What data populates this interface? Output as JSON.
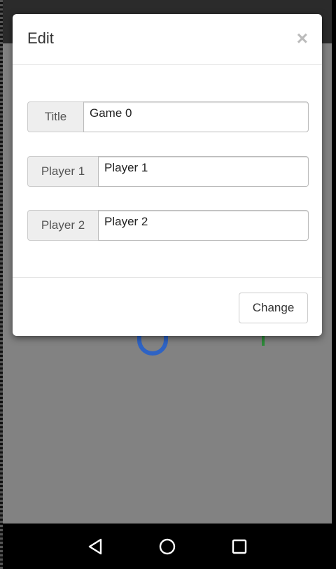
{
  "background_app": {
    "colors": {
      "content_bg": "#828282",
      "left_score_color": "#2e63c4",
      "right_score_color": "#2e8b3a"
    }
  },
  "dialog": {
    "title": "Edit",
    "close_label": "×",
    "fields": [
      {
        "label": "Title",
        "value": "Game 0"
      },
      {
        "label": "Player 1",
        "value": "Player 1"
      },
      {
        "label": "Player 2",
        "value": "Player 2"
      }
    ],
    "submit_label": "Change"
  },
  "nav_bar": {
    "icons": [
      "back-triangle-icon",
      "home-circle-icon",
      "recents-square-icon"
    ]
  }
}
